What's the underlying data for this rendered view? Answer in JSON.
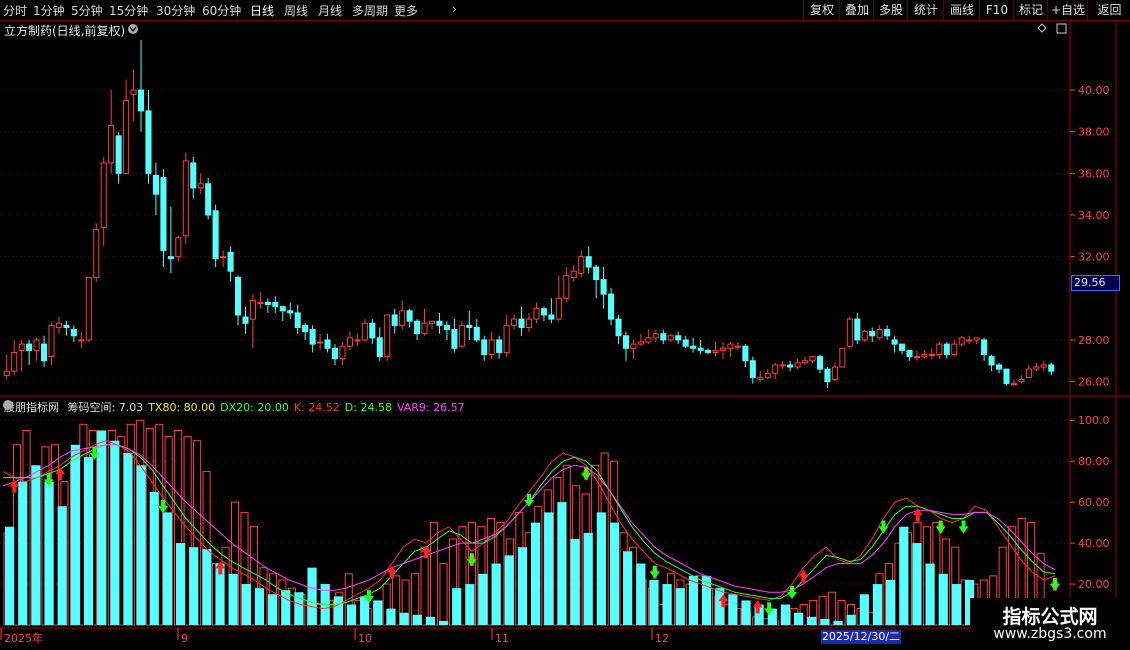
{
  "toolbar": {
    "left": [
      {
        "label": "分时",
        "x": 3
      },
      {
        "label": "1分钟",
        "x": 33
      },
      {
        "label": "5分钟",
        "x": 71
      },
      {
        "label": "15分钟",
        "x": 109
      },
      {
        "label": "30分钟",
        "x": 156
      },
      {
        "label": "60分钟",
        "x": 202
      },
      {
        "label": "日线",
        "x": 250,
        "active": true
      },
      {
        "label": "周线",
        "x": 284
      },
      {
        "label": "月线",
        "x": 318
      },
      {
        "label": "多周期",
        "x": 352
      },
      {
        "label": "更多",
        "x": 394
      }
    ],
    "more_arrow": "›",
    "right": [
      {
        "label": "复权",
        "x": 803,
        "w": 36
      },
      {
        "label": "叠加",
        "x": 839,
        "w": 34
      },
      {
        "label": "多股",
        "x": 873,
        "w": 34
      },
      {
        "label": "统计",
        "x": 907,
        "w": 36
      },
      {
        "label": "画线",
        "x": 943,
        "w": 36
      },
      {
        "label": "F10",
        "x": 979,
        "w": 34
      },
      {
        "label": "标记",
        "x": 1013,
        "w": 34
      },
      {
        "label": "+自选",
        "x": 1047,
        "w": 40
      },
      {
        "label": "返回",
        "x": 1087,
        "w": 43
      }
    ]
  },
  "main": {
    "title": "立方制药(日线,前复权)",
    "current_price_tag": "29.56",
    "price_axis": [
      "40.00",
      "38.00",
      "36.00",
      "34.00",
      "32.00",
      "28.00",
      "26.00"
    ],
    "colors": {
      "up": "#ff3c3c",
      "down": "#54ffff",
      "grid": "#6a0000",
      "axis": "#ff4040"
    }
  },
  "indicator": {
    "name": "股朋指标网",
    "values": [
      {
        "label": "筹码空间: 7.03",
        "color": "#e0e0e0"
      },
      {
        "label": "TX80: 80.00",
        "color": "#f0f000"
      },
      {
        "label": "DX20: 20.00",
        "color": "#30ff30"
      },
      {
        "label": "K: 24.52",
        "color": "#ff3030"
      },
      {
        "label": "D: 24.58",
        "color": "#30ff30"
      },
      {
        "label": "VAR9: 26.57",
        "color": "#ff40ff"
      }
    ],
    "axis": [
      "100.0",
      "80.00",
      "60.00",
      "40.00",
      "20.00"
    ]
  },
  "xaxis": {
    "labels": [
      {
        "t": "2025年",
        "x": 4
      },
      {
        "t": "9",
        "x": 181
      },
      {
        "t": "10",
        "x": 358
      },
      {
        "t": "11",
        "x": 495
      },
      {
        "t": "12",
        "x": 655
      }
    ],
    "date_tag": "2025/12/30/二"
  },
  "watermark": {
    "line1": "指标公式网",
    "line2": "www.zbgs3.com"
  },
  "chart_data": {
    "type": "candlestick",
    "title": "立方制药(日线,前复权)",
    "ylim": [
      25.5,
      42.5
    ],
    "candles": [
      [
        26.3,
        26.5,
        26.1,
        27.3
      ],
      [
        26.5,
        27.4,
        26.3,
        28.0
      ],
      [
        27.5,
        27.8,
        26.5,
        28.0
      ],
      [
        27.8,
        27.5,
        26.8,
        28.0
      ],
      [
        27.5,
        28.0,
        27.0,
        28.1
      ],
      [
        27.8,
        27.0,
        26.7,
        28.2
      ],
      [
        27.2,
        28.7,
        26.8,
        28.8
      ],
      [
        28.6,
        28.8,
        28.3,
        29.1
      ],
      [
        28.7,
        28.6,
        28.2,
        28.9
      ],
      [
        28.5,
        28.2,
        27.9,
        28.7
      ],
      [
        28.0,
        28.0,
        27.6,
        28.4
      ],
      [
        28.0,
        31.0,
        27.9,
        31.0
      ],
      [
        31.0,
        33.3,
        30.8,
        33.6
      ],
      [
        33.4,
        36.5,
        32.5,
        36.8
      ],
      [
        36.5,
        38.3,
        36.0,
        40.0
      ],
      [
        37.8,
        36.0,
        35.5,
        38.0
      ],
      [
        36.0,
        39.5,
        36.0,
        40.5
      ],
      [
        39.8,
        40.0,
        38.5,
        41.0
      ],
      [
        40.0,
        39.0,
        38.0,
        42.4
      ],
      [
        39.0,
        36.0,
        35.5,
        40.0
      ],
      [
        35.9,
        35.0,
        34.0,
        36.5
      ],
      [
        35.8,
        32.3,
        31.5,
        36.2
      ],
      [
        32.0,
        31.9,
        31.2,
        34.4
      ],
      [
        32.0,
        32.9,
        31.8,
        33.0
      ],
      [
        33.0,
        36.6,
        32.6,
        37.0
      ],
      [
        36.5,
        35.3,
        34.8,
        36.8
      ],
      [
        35.3,
        35.5,
        35.0,
        36.0
      ],
      [
        35.5,
        34.0,
        33.8,
        35.8
      ],
      [
        34.2,
        31.9,
        31.5,
        34.5
      ],
      [
        32.0,
        32.0,
        31.5,
        32.3
      ],
      [
        32.2,
        31.3,
        30.8,
        32.5
      ],
      [
        31.0,
        29.2,
        28.7,
        31.1
      ],
      [
        29.1,
        28.8,
        28.3,
        29.6
      ],
      [
        29.0,
        29.9,
        27.6,
        30.2
      ],
      [
        29.8,
        29.8,
        29.5,
        30.3
      ],
      [
        29.8,
        29.7,
        29.3,
        30.0
      ],
      [
        29.8,
        29.6,
        29.3,
        30.1
      ],
      [
        29.6,
        29.4,
        28.9,
        29.6
      ],
      [
        29.4,
        29.3,
        29.0,
        29.8
      ],
      [
        29.3,
        28.6,
        28.3,
        29.7
      ],
      [
        28.7,
        28.4,
        28.0,
        28.8
      ],
      [
        28.5,
        27.8,
        27.4,
        28.7
      ],
      [
        27.9,
        27.9,
        27.5,
        28.3
      ],
      [
        28.0,
        27.6,
        27.4,
        28.3
      ],
      [
        27.6,
        27.1,
        26.8,
        27.8
      ],
      [
        27.1,
        27.7,
        26.8,
        27.9
      ],
      [
        27.7,
        28.1,
        27.5,
        28.4
      ],
      [
        28.0,
        28.0,
        27.7,
        28.3
      ],
      [
        28.0,
        28.8,
        27.9,
        29.0
      ],
      [
        28.8,
        28.1,
        27.8,
        29.0
      ],
      [
        28.1,
        27.2,
        27.0,
        28.6
      ],
      [
        27.2,
        29.2,
        27.0,
        29.2
      ],
      [
        29.2,
        28.7,
        28.3,
        29.5
      ],
      [
        28.7,
        29.4,
        28.5,
        29.9
      ],
      [
        29.4,
        28.9,
        28.6,
        29.5
      ],
      [
        28.9,
        28.3,
        28.0,
        29.0
      ],
      [
        28.3,
        28.8,
        28.2,
        29.5
      ],
      [
        28.8,
        28.9,
        28.5,
        28.9
      ],
      [
        28.9,
        28.7,
        28.3,
        29.3
      ],
      [
        28.7,
        28.5,
        28.0,
        28.9
      ],
      [
        28.5,
        27.6,
        27.4,
        29.0
      ],
      [
        27.7,
        28.7,
        27.6,
        28.9
      ],
      [
        28.7,
        28.6,
        28.0,
        29.4
      ],
      [
        28.6,
        28.0,
        27.9,
        29.0
      ],
      [
        28.0,
        27.3,
        27.0,
        28.2
      ],
      [
        27.3,
        28.0,
        27.1,
        28.4
      ],
      [
        28.0,
        27.4,
        27.1,
        28.2
      ],
      [
        27.4,
        28.7,
        27.2,
        29.2
      ],
      [
        28.7,
        29.0,
        28.5,
        29.2
      ],
      [
        29.0,
        28.6,
        28.2,
        29.6
      ],
      [
        28.6,
        29.0,
        28.4,
        29.3
      ],
      [
        29.0,
        29.5,
        28.8,
        29.8
      ],
      [
        29.5,
        29.2,
        28.9,
        29.6
      ],
      [
        29.2,
        29.0,
        28.8,
        30.0
      ],
      [
        29.0,
        30.0,
        28.9,
        31.1
      ],
      [
        30.0,
        31.1,
        29.8,
        31.5
      ],
      [
        31.0,
        31.3,
        30.8,
        31.6
      ],
      [
        31.2,
        32.0,
        31.0,
        32.3
      ],
      [
        32.0,
        31.5,
        31.2,
        32.5
      ],
      [
        31.5,
        30.9,
        30.0,
        31.6
      ],
      [
        30.9,
        30.2,
        29.5,
        31.5
      ],
      [
        30.2,
        29.0,
        28.7,
        30.5
      ],
      [
        29.0,
        28.2,
        27.8,
        29.2
      ],
      [
        28.2,
        27.6,
        27.0,
        28.4
      ],
      [
        27.6,
        27.8,
        27.1,
        28.0
      ],
      [
        27.8,
        27.9,
        27.7,
        28.3
      ],
      [
        27.9,
        28.1,
        27.8,
        28.5
      ],
      [
        28.1,
        28.3,
        27.9,
        28.5
      ],
      [
        28.3,
        28.0,
        27.8,
        28.5
      ],
      [
        28.0,
        28.2,
        27.9,
        28.3
      ],
      [
        28.2,
        28.0,
        27.8,
        28.4
      ],
      [
        28.0,
        27.7,
        27.6,
        28.2
      ],
      [
        27.7,
        27.6,
        27.4,
        28.1
      ],
      [
        27.6,
        27.5,
        27.3,
        28.0
      ],
      [
        27.5,
        27.4,
        27.3,
        27.6
      ],
      [
        27.4,
        27.5,
        27.2,
        27.9
      ],
      [
        27.5,
        27.6,
        27.1,
        27.9
      ],
      [
        27.6,
        27.8,
        27.2,
        27.9
      ],
      [
        27.7,
        27.7,
        27.5,
        27.9
      ],
      [
        27.7,
        27.0,
        26.7,
        27.8
      ],
      [
        27.0,
        26.2,
        25.9,
        27.2
      ],
      [
        26.1,
        26.2,
        26.0,
        26.5
      ],
      [
        26.2,
        26.4,
        26.1,
        26.6
      ],
      [
        26.4,
        26.8,
        26.1,
        26.9
      ],
      [
        26.8,
        26.8,
        26.6,
        27.0
      ],
      [
        26.8,
        26.7,
        26.5,
        27.0
      ],
      [
        26.7,
        26.9,
        26.6,
        27.1
      ],
      [
        26.9,
        27.0,
        26.8,
        27.2
      ],
      [
        27.0,
        27.2,
        26.9,
        27.2
      ],
      [
        27.2,
        26.6,
        26.4,
        27.3
      ],
      [
        26.6,
        26.0,
        25.7,
        26.7
      ],
      [
        26.1,
        26.7,
        26.0,
        26.9
      ],
      [
        26.7,
        27.6,
        26.7,
        27.6
      ],
      [
        27.7,
        29.0,
        27.6,
        29.1
      ],
      [
        29.0,
        28.0,
        27.8,
        29.3
      ],
      [
        28.0,
        28.4,
        27.9,
        28.5
      ],
      [
        28.4,
        28.2,
        27.9,
        28.6
      ],
      [
        28.1,
        28.5,
        28.0,
        28.7
      ],
      [
        28.5,
        28.2,
        28.0,
        28.7
      ],
      [
        28.0,
        27.8,
        27.4,
        28.2
      ],
      [
        27.8,
        27.5,
        27.3,
        27.7
      ],
      [
        27.5,
        27.2,
        27.0,
        27.5
      ],
      [
        27.2,
        27.2,
        27.0,
        27.5
      ],
      [
        27.2,
        27.3,
        27.1,
        27.5
      ],
      [
        27.3,
        27.3,
        27.1,
        27.6
      ],
      [
        27.3,
        27.8,
        27.1,
        27.9
      ],
      [
        27.8,
        27.3,
        27.1,
        27.9
      ],
      [
        27.3,
        27.8,
        27.2,
        28.0
      ],
      [
        27.8,
        28.1,
        27.7,
        28.2
      ],
      [
        28.0,
        28.0,
        27.8,
        28.2
      ],
      [
        28.0,
        28.1,
        27.8,
        28.1
      ],
      [
        28.0,
        27.3,
        27.0,
        28.1
      ],
      [
        27.2,
        26.8,
        26.5,
        27.3
      ],
      [
        26.8,
        26.6,
        26.4,
        26.9
      ],
      [
        26.6,
        25.9,
        25.8,
        26.6
      ],
      [
        25.9,
        25.9,
        25.8,
        26.1
      ],
      [
        26.0,
        26.1,
        25.9,
        26.3
      ],
      [
        26.2,
        26.6,
        26.2,
        26.8
      ],
      [
        26.6,
        26.7,
        26.5,
        26.9
      ],
      [
        26.7,
        26.8,
        26.5,
        27.0
      ],
      [
        26.8,
        26.5,
        26.3,
        26.9
      ]
    ],
    "indicator_ylim": [
      0,
      105
    ],
    "histogram_red": [
      45,
      88,
      95,
      40,
      87,
      88,
      70,
      80,
      98,
      95,
      90,
      95,
      92,
      98,
      100,
      96,
      98,
      92,
      95,
      92,
      90,
      75,
      30,
      38,
      60,
      55,
      48,
      28,
      25,
      22,
      18,
      15,
      12,
      10,
      12,
      16,
      25,
      12,
      8,
      10,
      20,
      24,
      22,
      25,
      38,
      50,
      30,
      42,
      48,
      50,
      48,
      52,
      50,
      42,
      55,
      45,
      58,
      66,
      72,
      78,
      68,
      64,
      78,
      84,
      80,
      45,
      38,
      22,
      18,
      10,
      25,
      22,
      20,
      24,
      18,
      14,
      10,
      8,
      6,
      4,
      3,
      2,
      5,
      8,
      10,
      12,
      14,
      16,
      12,
      10,
      8,
      6,
      25,
      30,
      40,
      45,
      50,
      48,
      50,
      42,
      38,
      22,
      20,
      22,
      24,
      38,
      48,
      52,
      50,
      35,
      12
    ],
    "histogram_cyan": [
      48,
      70,
      78,
      70,
      58,
      88,
      82,
      95,
      90,
      84,
      78,
      65,
      55,
      40,
      38,
      37,
      30,
      25,
      20,
      18,
      15,
      17,
      16,
      28,
      20,
      14,
      10,
      14,
      12,
      8,
      6,
      5,
      4,
      2,
      18,
      20,
      25,
      30,
      34,
      38,
      50,
      55,
      60,
      42,
      45,
      55,
      50,
      36,
      30,
      22,
      20,
      18,
      24,
      24,
      18,
      15,
      12,
      10,
      8,
      10,
      6,
      4,
      3,
      2,
      5,
      15,
      20,
      22,
      48,
      40,
      30,
      25,
      20,
      22,
      8,
      6,
      5,
      2,
      4,
      8
    ],
    "series": [
      {
        "name": "K",
        "values": [
          75,
          72,
          70,
          72,
          75,
          78,
          82,
          85,
          88,
          90,
          88,
          85,
          78,
          70,
          62,
          55,
          48,
          42,
          36,
          32,
          28,
          25,
          22,
          18,
          15,
          12,
          10,
          9,
          8,
          9,
          12,
          15,
          18,
          22,
          30,
          38,
          42,
          40,
          45,
          48,
          42,
          36,
          40,
          45,
          50,
          58,
          65,
          72,
          80,
          84,
          82,
          78,
          70,
          60,
          50,
          42,
          36,
          30,
          28,
          25,
          22,
          20,
          18,
          16,
          15,
          14,
          13,
          12,
          14,
          20,
          28,
          34,
          38,
          32,
          30,
          34,
          42,
          52,
          60,
          62,
          58,
          56,
          52,
          50,
          52,
          58,
          56,
          48,
          40,
          32,
          26,
          22,
          24
        ]
      },
      {
        "name": "D",
        "values": [
          72,
          72,
          72,
          72,
          74,
          76,
          80,
          83,
          86,
          88,
          88,
          86,
          82,
          76,
          68,
          60,
          52,
          46,
          40,
          35,
          31,
          28,
          25,
          22,
          18,
          15,
          13,
          11,
          10,
          10,
          11,
          13,
          15,
          18,
          24,
          30,
          36,
          38,
          42,
          46,
          44,
          40,
          40,
          43,
          48,
          54,
          60,
          68,
          75,
          80,
          82,
          80,
          75,
          66,
          57,
          48,
          41,
          35,
          31,
          28,
          25,
          22,
          20,
          18,
          16,
          15,
          14,
          13,
          13,
          16,
          22,
          28,
          34,
          33,
          31,
          32,
          38,
          46,
          54,
          58,
          58,
          56,
          54,
          52,
          52,
          55,
          55,
          50,
          44,
          37,
          31,
          26,
          25
        ]
      },
      {
        "name": "VAR9",
        "values": [
          68,
          70,
          72,
          75,
          78,
          82,
          85,
          86,
          87,
          88,
          88,
          86,
          83,
          78,
          72,
          66,
          60,
          55,
          50,
          45,
          40,
          36,
          32,
          28,
          25,
          22,
          20,
          18,
          17,
          17,
          18,
          20,
          22,
          25,
          28,
          30,
          32,
          34,
          36,
          38,
          40,
          40,
          42,
          44,
          48,
          54,
          60,
          66,
          72,
          76,
          78,
          77,
          73,
          66,
          58,
          50,
          44,
          38,
          34,
          31,
          28,
          25,
          23,
          21,
          19,
          18,
          17,
          16,
          16,
          17,
          20,
          24,
          28,
          30,
          30,
          30,
          34,
          40,
          48,
          54,
          56,
          56,
          55,
          54,
          54,
          55,
          55,
          52,
          47,
          41,
          35,
          30,
          27
        ]
      }
    ],
    "buy_arrows_red": [
      2,
      8,
      26,
      47,
      51,
      56,
      70,
      77,
      85,
      90,
      95,
      109,
      111,
      124
    ],
    "sell_arrows_green": [
      6,
      12,
      19,
      44,
      56,
      62,
      69,
      77,
      91,
      94,
      105,
      111,
      114,
      124
    ]
  }
}
